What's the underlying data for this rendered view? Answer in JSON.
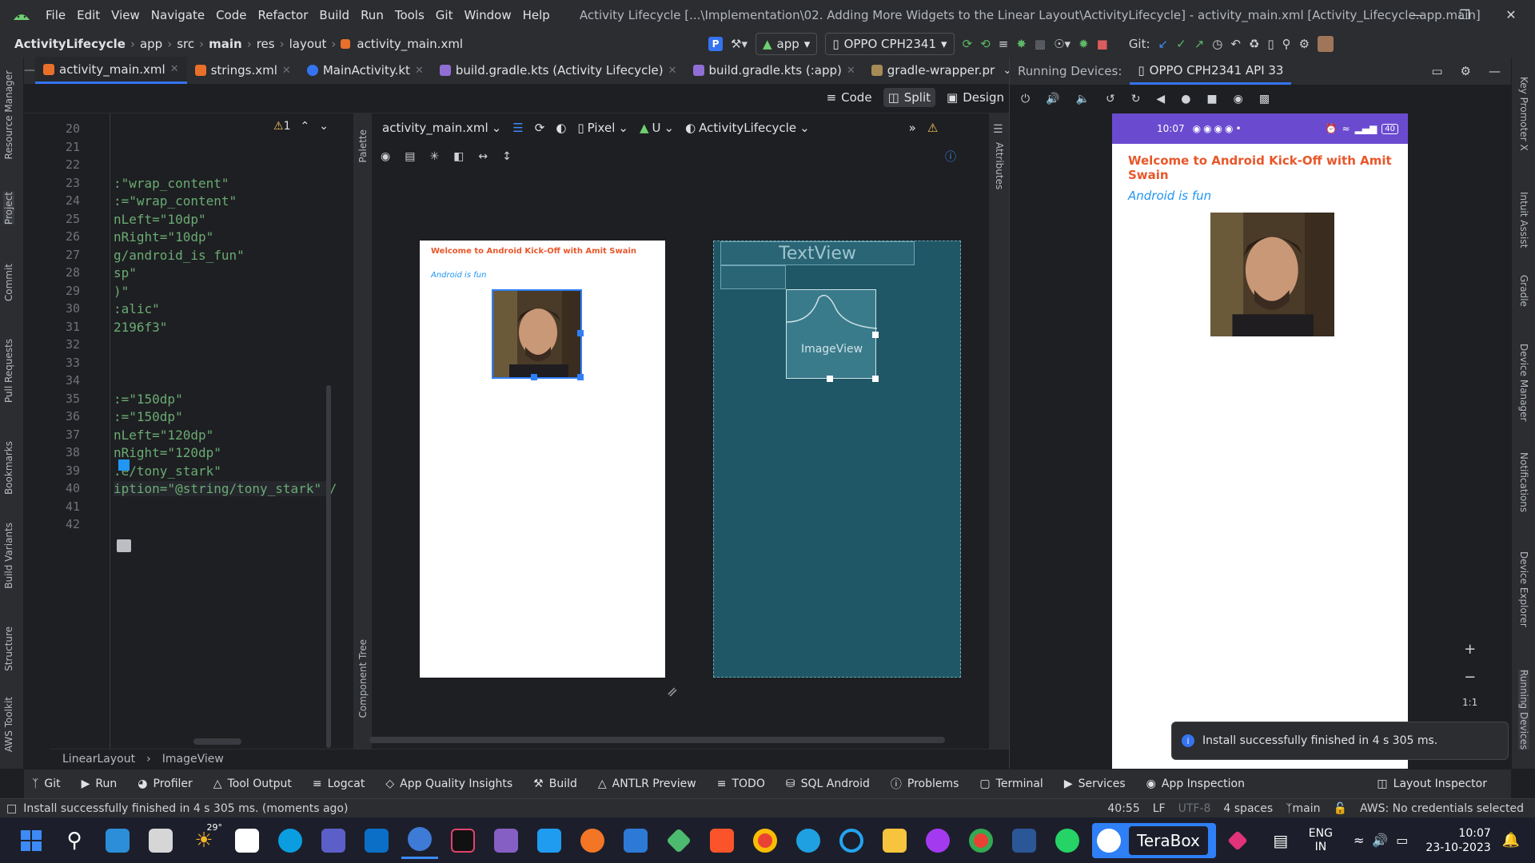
{
  "menubar": {
    "items": [
      "File",
      "Edit",
      "View",
      "Navigate",
      "Code",
      "Refactor",
      "Build",
      "Run",
      "Tools",
      "Git",
      "Window",
      "Help"
    ],
    "window_title": "Activity Lifecycle [...\\Implementation\\02. Adding More Widgets to the Linear Layout\\ActivityLifecycle] - activity_main.xml [Activity_Lifecycle.app.main]"
  },
  "breadcrumb": [
    "ActivityLifecycle",
    "app",
    "src",
    "main",
    "res",
    "layout",
    "activity_main.xml"
  ],
  "toolbar": {
    "run_config": "app",
    "device": "OPPO CPH2341",
    "git_label": "Git:"
  },
  "tabs": [
    {
      "label": "activity_main.xml",
      "color": "#e8702a"
    },
    {
      "label": "strings.xml",
      "color": "#e8702a"
    },
    {
      "label": "MainActivity.kt",
      "color": "#3574f0"
    },
    {
      "label": "build.gradle.kts (Activity Lifecycle)",
      "color": "#8f6fd6"
    },
    {
      "label": "build.gradle.kts (:app)",
      "color": "#8f6fd6"
    },
    {
      "label": "gradle-wrapper.pr",
      "color": "#a78b56"
    }
  ],
  "view_modes": {
    "code": "Code",
    "split": "Split",
    "design": "Design"
  },
  "editor": {
    "warning_count": "1",
    "lines": [
      {
        "n": "20",
        "t": ""
      },
      {
        "n": "21",
        "t": ""
      },
      {
        "n": "22",
        "t": ""
      },
      {
        "n": "23",
        "t": ":\"wrap_content\""
      },
      {
        "n": "24",
        "t": ":=\"wrap_content\""
      },
      {
        "n": "25",
        "t": "nLeft=\"10dp\""
      },
      {
        "n": "26",
        "t": "nRight=\"10dp\""
      },
      {
        "n": "27",
        "t": "g/android_is_fun\""
      },
      {
        "n": "28",
        "t": "sp\""
      },
      {
        "n": "29",
        "t": ")\""
      },
      {
        "n": "30",
        "t": ":alic\""
      },
      {
        "n": "31",
        "t": "2196f3\""
      },
      {
        "n": "32",
        "t": ""
      },
      {
        "n": "33",
        "t": ""
      },
      {
        "n": "34",
        "t": ""
      },
      {
        "n": "35",
        "t": ":=\"150dp\""
      },
      {
        "n": "36",
        "t": ":=\"150dp\""
      },
      {
        "n": "37",
        "t": "nLeft=\"120dp\""
      },
      {
        "n": "38",
        "t": "nRight=\"120dp\""
      },
      {
        "n": "39",
        "t": ".e/tony_stark\""
      },
      {
        "n": "40",
        "t": "iption=\"@string/tony_stark\" /"
      },
      {
        "n": "41",
        "t": ""
      },
      {
        "n": "42",
        "t": ""
      }
    ]
  },
  "design_toolbar": {
    "file": "activity_main.xml",
    "device": "Pixel",
    "api": "U",
    "theme": "ActivityLifecycle"
  },
  "preview": {
    "title": "Welcome to Android Kick-Off with Amit Swain",
    "subtitle": "Android is fun",
    "title_color": "#e8572a",
    "subtitle_color": "#2196f3"
  },
  "blueprint": {
    "textview": "TextView",
    "imageview": "ImageView"
  },
  "side_labels": {
    "left": [
      "Resource Manager",
      "Project",
      "Commit",
      "Pull Requests",
      "Bookmarks",
      "Build Variants",
      "Structure",
      "AWS Toolkit"
    ],
    "right": [
      "Key Promoter X",
      "Intuit Assist",
      "Gradle",
      "Device Manager",
      "Notifications",
      "Device Explorer",
      "Running Devices"
    ],
    "palette": "Palette",
    "component_tree": "Component Tree",
    "attributes": "Attributes"
  },
  "editor_breadcrumb": [
    "LinearLayout",
    "ImageView"
  ],
  "running_devices": {
    "title": "Running Devices:",
    "tab": "OPPO CPH2341 API 33",
    "time": "10:07",
    "battery": "40",
    "zoom_reset": "1:1"
  },
  "toast": "Install successfully finished in 4 s 305 ms.",
  "bottom_tools": [
    "Git",
    "Run",
    "Profiler",
    "Tool Output",
    "Logcat",
    "App Quality Insights",
    "Build",
    "ANTLR Preview",
    "TODO",
    "SQL Android",
    "Problems",
    "Terminal",
    "Services",
    "App Inspection",
    "Layout Inspector"
  ],
  "statusline": {
    "message": "Install successfully finished in 4 s 305 ms. (moments ago)",
    "position": "40:55",
    "line_sep": "LF",
    "encoding": "UTF-8",
    "indent": "4 spaces",
    "branch": "main",
    "aws": "AWS: No credentials selected"
  },
  "taskbar": {
    "weather": "29°",
    "terabox": "TeraBox",
    "lang1": "ENG",
    "lang2": "IN",
    "time": "10:07",
    "date": "23-10-2023"
  }
}
